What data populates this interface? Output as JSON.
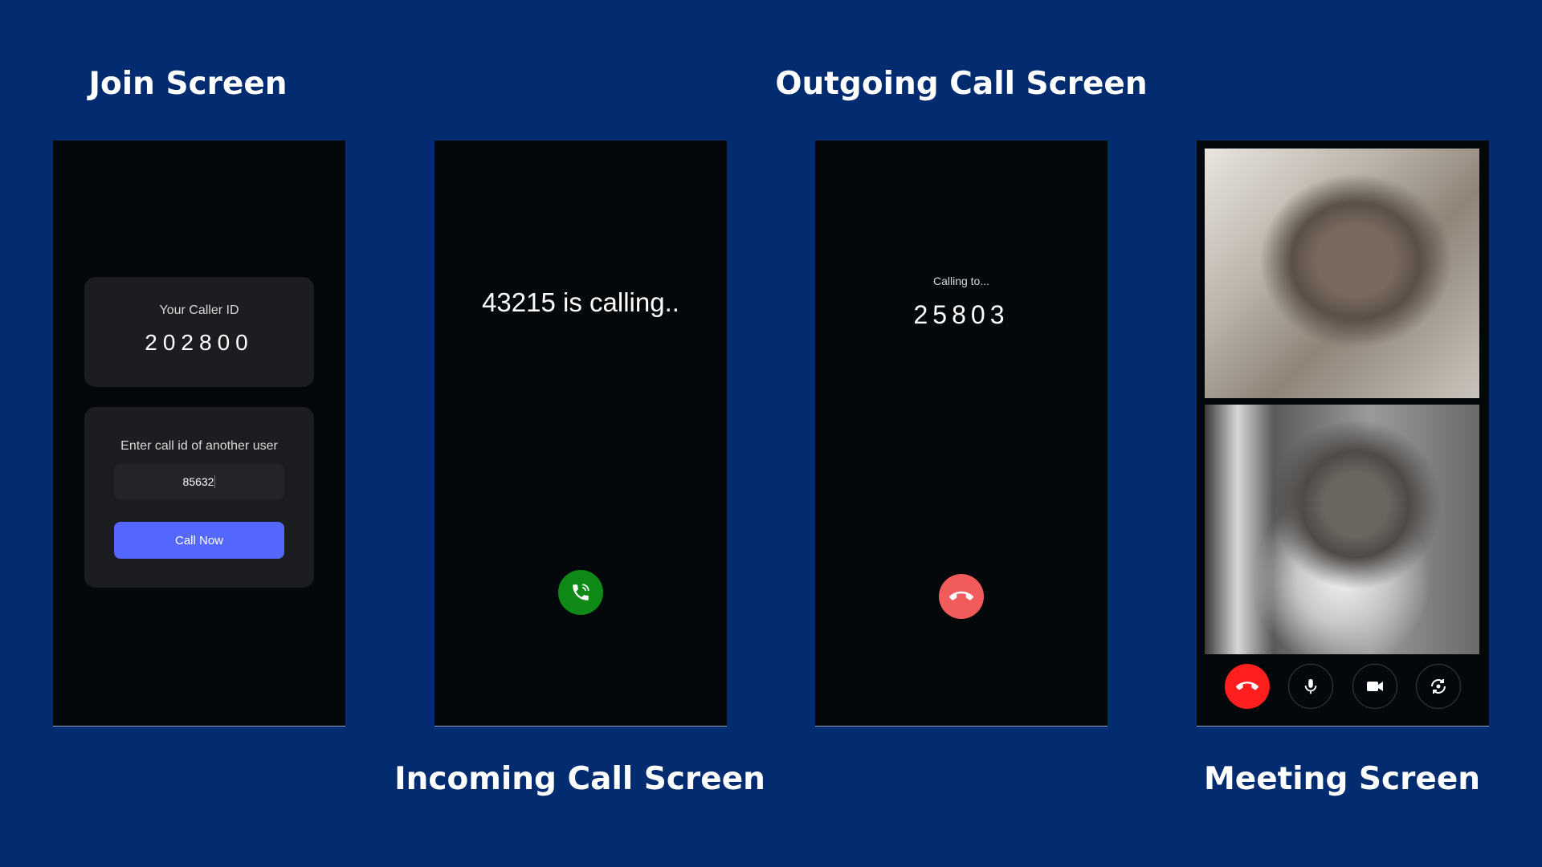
{
  "titles": {
    "join": "Join Screen",
    "outgoing": "Outgoing Call Screen",
    "incoming": "Incoming Call Screen",
    "meeting": "Meeting Screen"
  },
  "join": {
    "caller_id_label": "Your Caller ID",
    "caller_id": "202800",
    "enter_label": "Enter call id of another user",
    "input_value": "85632",
    "call_button": "Call Now"
  },
  "incoming": {
    "message": "43215 is calling..",
    "accept_icon": "phone-icon",
    "accept_color": "#0f8a16"
  },
  "outgoing": {
    "label": "Calling to...",
    "callee_id": "25803",
    "end_icon": "phone-hangup-icon",
    "end_color": "#f25b5b"
  },
  "meeting": {
    "controls": [
      "phone-hangup-icon",
      "microphone-icon",
      "video-camera-icon",
      "camera-switch-icon"
    ],
    "end_color": "#ff1f1f"
  },
  "colors": {
    "background": "#022c6f",
    "accent": "#5568fe"
  }
}
